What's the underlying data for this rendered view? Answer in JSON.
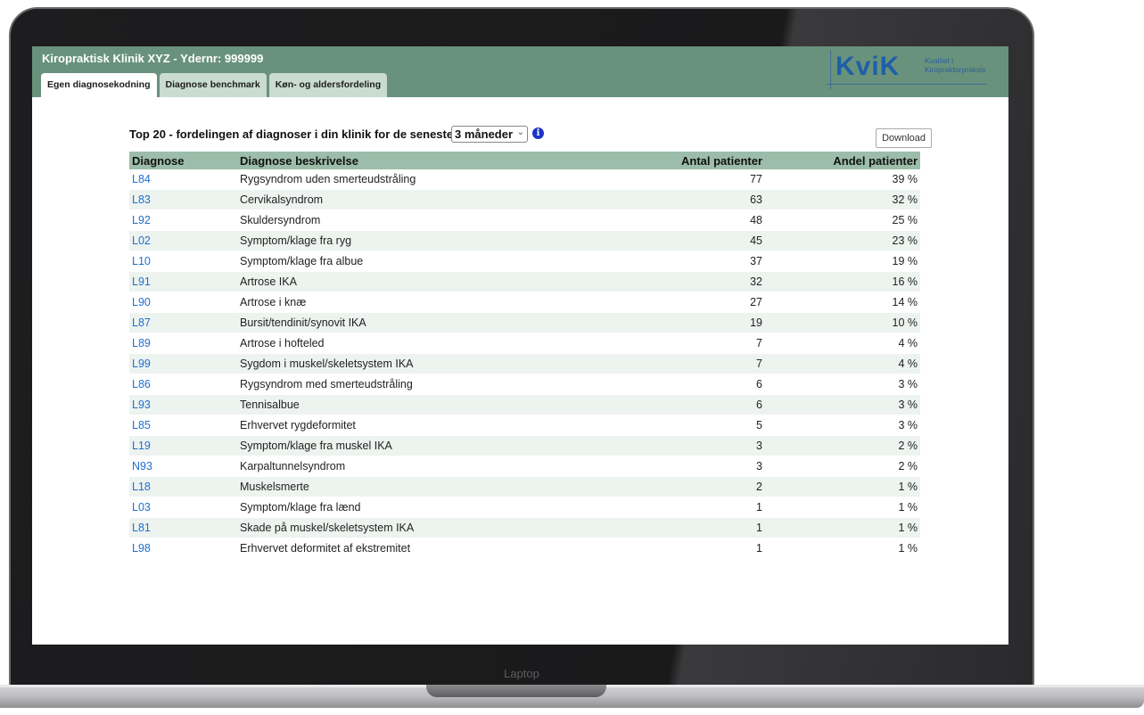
{
  "app": {
    "title": "Kiropraktisk Klinik XYZ - Ydernr: 999999",
    "tabs": [
      {
        "label": "Egen diagnosekodning",
        "active": true
      },
      {
        "label": "Diagnose benchmark",
        "active": false
      },
      {
        "label": "Køn- og aldersfordeling",
        "active": false
      }
    ],
    "logo": {
      "word": "KviK",
      "tagline_1": "Kvalitet i",
      "tagline_2": "Kiropraktorpraksis"
    }
  },
  "report": {
    "title": "Top 20 - fordelingen af diagnoser i din klinik for de seneste",
    "period_selected": "3 måneder",
    "download_label": "Download"
  },
  "table": {
    "headers": [
      "Diagnose",
      "Diagnose beskrivelse",
      "Antal patienter",
      "Andel patienter"
    ],
    "rows": [
      {
        "code": "L84",
        "desc": "Rygsyndrom uden smerteudstråling",
        "count": "77",
        "share": "39 %"
      },
      {
        "code": "L83",
        "desc": "Cervikalsyndrom",
        "count": "63",
        "share": "32 %"
      },
      {
        "code": "L92",
        "desc": "Skuldersyndrom",
        "count": "48",
        "share": "25 %"
      },
      {
        "code": "L02",
        "desc": "Symptom/klage fra ryg",
        "count": "45",
        "share": "23 %"
      },
      {
        "code": "L10",
        "desc": "Symptom/klage fra albue",
        "count": "37",
        "share": "19 %"
      },
      {
        "code": "L91",
        "desc": "Artrose IKA",
        "count": "32",
        "share": "16 %"
      },
      {
        "code": "L90",
        "desc": "Artrose i knæ",
        "count": "27",
        "share": "14 %"
      },
      {
        "code": "L87",
        "desc": "Bursit/tendinit/synovit IKA",
        "count": "19",
        "share": "10 %"
      },
      {
        "code": "L89",
        "desc": "Artrose i hofteled",
        "count": "7",
        "share": "4 %"
      },
      {
        "code": "L99",
        "desc": "Sygdom i muskel/skeletsystem IKA",
        "count": "7",
        "share": "4 %"
      },
      {
        "code": "L86",
        "desc": "Rygsyndrom med smerteudstråling",
        "count": "6",
        "share": "3 %"
      },
      {
        "code": "L93",
        "desc": "Tennisalbue",
        "count": "6",
        "share": "3 %"
      },
      {
        "code": "L85",
        "desc": "Erhvervet rygdeformitet",
        "count": "5",
        "share": "3 %"
      },
      {
        "code": "L19",
        "desc": "Symptom/klage fra muskel IKA",
        "count": "3",
        "share": "2 %"
      },
      {
        "code": "N93",
        "desc": "Karpaltunnelsyndrom",
        "count": "3",
        "share": "2 %"
      },
      {
        "code": "L18",
        "desc": "Muskelsmerte",
        "count": "2",
        "share": "1 %"
      },
      {
        "code": "L03",
        "desc": "Symptom/klage fra lænd",
        "count": "1",
        "share": "1 %"
      },
      {
        "code": "L81",
        "desc": "Skade på muskel/skeletsystem IKA",
        "count": "1",
        "share": "1 %"
      },
      {
        "code": "L98",
        "desc": "Erhvervet deformitet af ekstremitet",
        "count": "1",
        "share": "1 %"
      }
    ]
  },
  "device": {
    "label": "Laptop"
  },
  "colors": {
    "header_bg": "#68927c",
    "table_header_bg": "#9cbda9",
    "link": "#1e6fd1",
    "row_alt": "#edf3ef"
  }
}
